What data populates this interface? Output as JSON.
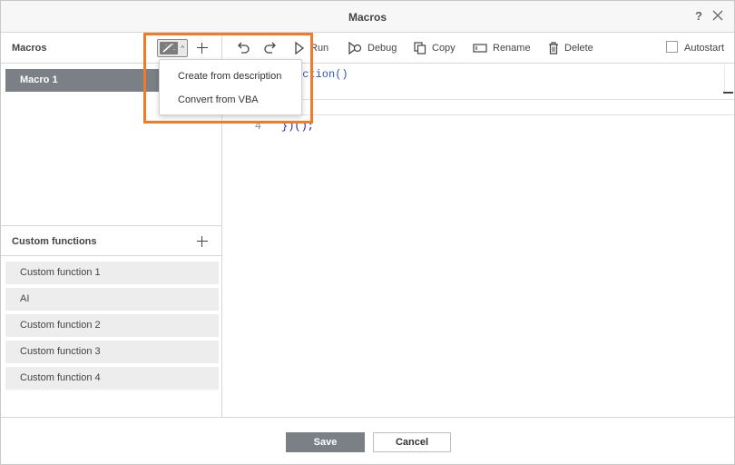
{
  "dialog": {
    "title": "Macros",
    "help_label": "?"
  },
  "macros_panel": {
    "title": "Macros",
    "items": [
      {
        "label": "Macro 1",
        "selected": true
      }
    ]
  },
  "ai_menu": {
    "items": [
      {
        "label": "Create from description"
      },
      {
        "label": "Convert from VBA"
      }
    ]
  },
  "custom_functions": {
    "title": "Custom functions",
    "items": [
      {
        "label": "Custom function 1"
      },
      {
        "label": "AI"
      },
      {
        "label": "Custom function 2"
      },
      {
        "label": "Custom function 3"
      },
      {
        "label": "Custom function 4"
      }
    ]
  },
  "toolbar": {
    "undo_icon": "undo-icon",
    "redo_icon": "redo-icon",
    "run_label": "Run",
    "debug_label": "Debug",
    "copy_label": "Copy",
    "rename_label": "Rename",
    "delete_label": "Delete",
    "autostart_label": "Autostart",
    "autostart_checked": false
  },
  "editor": {
    "lines": [
      {
        "number": "",
        "code_prefix": "",
        "code_fn": "nction()"
      },
      {
        "number": "4",
        "code_prefix": "})();",
        "code_fn": ""
      }
    ]
  },
  "footer": {
    "save_label": "Save",
    "cancel_label": "Cancel"
  },
  "colors": {
    "highlight": "#f07c2a",
    "selected_item": "#7b7f86"
  }
}
